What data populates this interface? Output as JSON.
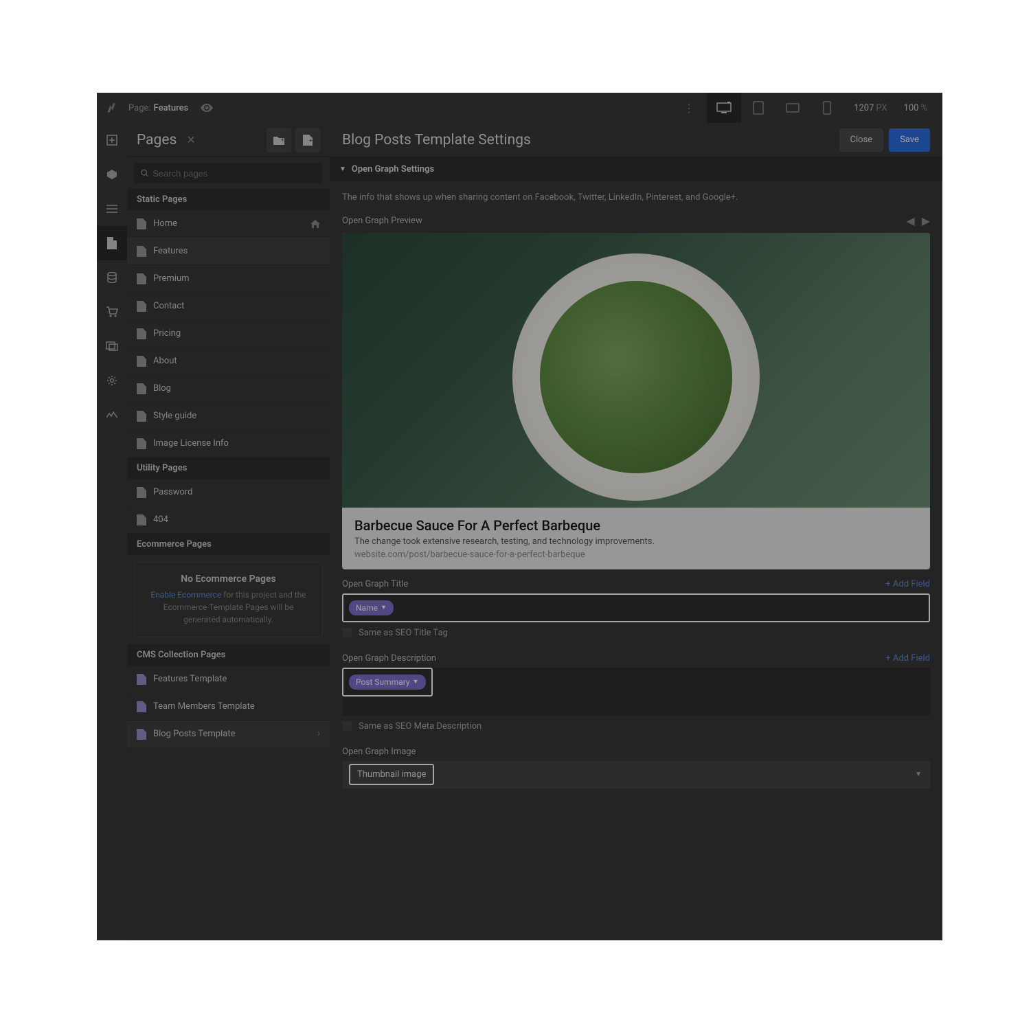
{
  "topbar": {
    "page_label": "Page:",
    "page_name": "Features",
    "width_value": "1207",
    "width_unit": "PX",
    "zoom_value": "100",
    "zoom_unit": "%"
  },
  "pages_panel": {
    "title": "Pages",
    "search_placeholder": "Search pages",
    "static_header": "Static Pages",
    "static_pages": [
      "Home",
      "Features",
      "Premium",
      "Contact",
      "Pricing",
      "About",
      "Blog",
      "Style guide",
      "Image License Info"
    ],
    "utility_header": "Utility Pages",
    "utility_pages": [
      "Password",
      "404"
    ],
    "ecommerce_header": "Ecommerce Pages",
    "ecom_empty_title": "No Ecommerce Pages",
    "ecom_link": "Enable Ecommerce",
    "ecom_text_rest": " for this project and the Ecommerce Template Pages will be generated automatically.",
    "cms_header": "CMS Collection Pages",
    "cms_pages": [
      "Features Template",
      "Team Members Template",
      "Blog Posts Template"
    ]
  },
  "main": {
    "title": "Blog Posts Template Settings",
    "close_label": "Close",
    "save_label": "Save",
    "section_title": "Open Graph Settings",
    "info_text": "The info that shows up when sharing content on Facebook, Twitter, LinkedIn, Pinterest, and Google+.",
    "preview_label": "Open Graph Preview",
    "og_title": "Barbecue Sauce For A Perfect Barbeque",
    "og_desc": "The change took extensive research, testing, and technology improvements.",
    "og_url": "website.com/post/barbecue-sauce-for-a-perfect-barbeque",
    "title_field_label": "Open Graph Title",
    "add_field_label": "+ Add Field",
    "title_pill": "Name",
    "same_title_label": "Same as SEO Title Tag",
    "desc_field_label": "Open Graph Description",
    "desc_pill": "Post Summary",
    "same_desc_label": "Same as SEO Meta Description",
    "image_field_label": "Open Graph Image",
    "image_value": "Thumbnail image"
  }
}
